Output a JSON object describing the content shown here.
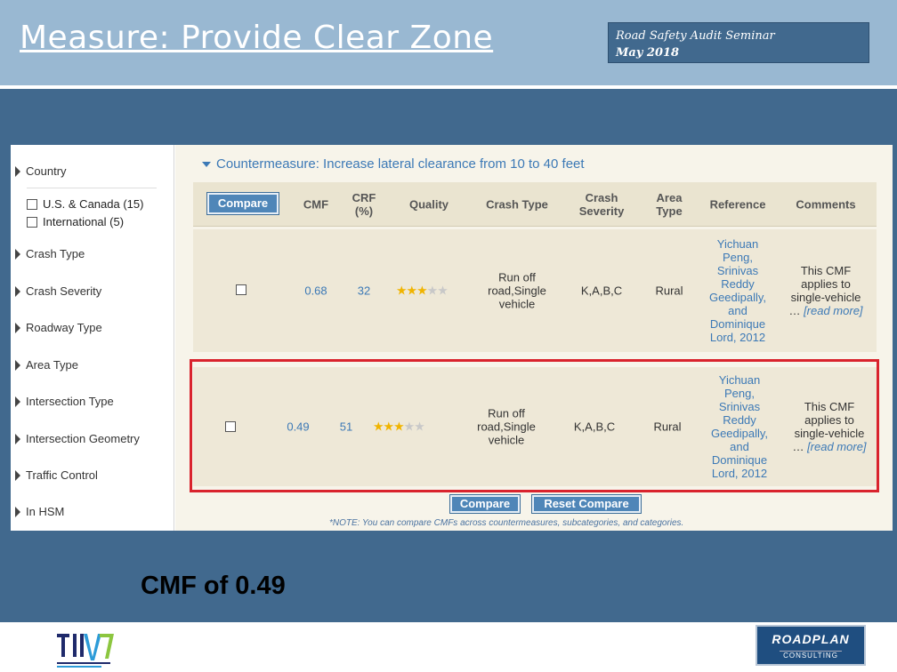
{
  "slide": {
    "title": "Measure: Provide Clear Zone",
    "seminar_name": "Road Safety Audit Seminar",
    "seminar_date": "May 2018",
    "callout": "CMF of 0.49"
  },
  "sidebar": {
    "items": [
      {
        "label": "Country"
      },
      {
        "label": "Crash Type"
      },
      {
        "label": "Crash Severity"
      },
      {
        "label": "Roadway Type"
      },
      {
        "label": "Area Type"
      },
      {
        "label": "Intersection Type"
      },
      {
        "label": "Intersection Geometry"
      },
      {
        "label": "Traffic Control"
      },
      {
        "label": "In HSM"
      }
    ],
    "country_options": [
      {
        "label": "U.S. & Canada (15)"
      },
      {
        "label": "International (5)"
      }
    ]
  },
  "countermeasure": {
    "title": "Countermeasure: Increase lateral clearance from 10 to 40 feet"
  },
  "table": {
    "compare_button": "Compare",
    "headers": {
      "cmf": "CMF",
      "crf": "CRF (%)",
      "quality": "Quality",
      "crash_type": "Crash Type",
      "crash_severity": "Crash Severity",
      "area_type": "Area Type",
      "reference": "Reference",
      "comments": "Comments"
    },
    "rows": [
      {
        "cmf": "0.68",
        "crf": "32",
        "quality_stars": 3,
        "crash_type": "Run off road,Single vehicle",
        "crash_severity": "K,A,B,C",
        "area_type": "Rural",
        "reference": "Yichuan Peng, Srinivas Reddy Geedipally, and Dominique Lord, 2012",
        "comment": "This CMF applies to single-vehicle …",
        "read_more": "[read more]"
      },
      {
        "cmf": "0.49",
        "crf": "51",
        "quality_stars": 3,
        "crash_type": "Run off road,Single vehicle",
        "crash_severity": "K,A,B,C",
        "area_type": "Rural",
        "reference": "Yichuan Peng, Srinivas Reddy Geedipally, and Dominique Lord, 2012",
        "comment": "This CMF applies to single-vehicle …",
        "read_more": "[read more]"
      }
    ]
  },
  "footer_buttons": {
    "compare": "Compare",
    "reset_compare": "Reset Compare"
  },
  "note": "*NOTE: You can compare CMFs across countermeasures, subcategories, and categories.",
  "logos": {
    "roadplan_line1": "ROADPLAN",
    "roadplan_line2": "CONSULTING"
  },
  "colors": {
    "header_band": "#99b8d2",
    "slide_bg": "#41698e",
    "link_blue": "#3c79b6",
    "highlight_red": "#d9232d",
    "star_gold": "#f0b400"
  }
}
